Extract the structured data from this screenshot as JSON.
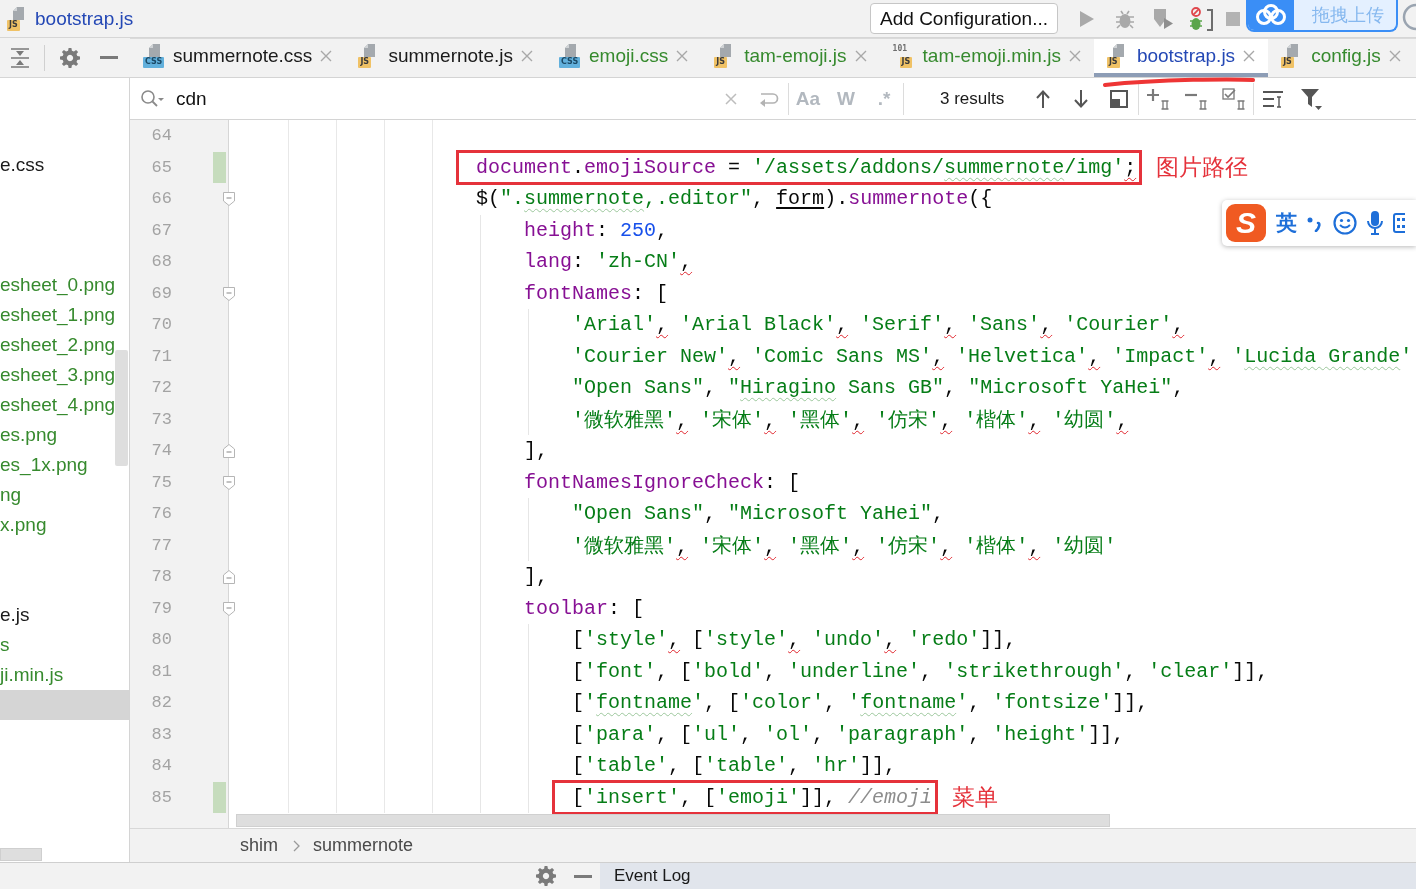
{
  "title": {
    "name": "bootstrap.js",
    "kind": "js",
    "icon_label": "JS",
    "color": "#2448b5"
  },
  "run_config": {
    "label": "Add Configuration..."
  },
  "upload_widget": {
    "label": "拖拽上传"
  },
  "tabs": [
    {
      "name": "summernote.css",
      "kind": "css",
      "icon_label": "CSS",
      "color": "#1a1a1a",
      "selected": false,
      "marked": false
    },
    {
      "name": "summernote.js",
      "kind": "js",
      "icon_label": "JS",
      "color": "#1a1a1a",
      "selected": false,
      "marked": false
    },
    {
      "name": "emoji.css",
      "kind": "css",
      "icon_label": "CSS",
      "color": "#368a2e",
      "selected": false,
      "marked": false
    },
    {
      "name": "tam-emoji.js",
      "kind": "js",
      "icon_label": "JS",
      "color": "#368a2e",
      "selected": false,
      "marked": false
    },
    {
      "name": "tam-emoji.min.js",
      "kind": "min_js",
      "icon_label": "JS",
      "icon_digits": "101",
      "color": "#368a2e",
      "selected": false,
      "marked": false
    },
    {
      "name": "bootstrap.js",
      "kind": "js",
      "icon_label": "JS",
      "color": "#2448b5",
      "selected": true,
      "marked": true
    },
    {
      "name": "config.js",
      "kind": "js",
      "icon_label": "JS",
      "color": "#368a2e",
      "selected": false,
      "marked": false
    }
  ],
  "search": {
    "value": "cdn",
    "options": [
      {
        "label": "Aa",
        "selected": false
      },
      {
        "label": "W",
        "selected": false
      },
      {
        "label": ".*",
        "selected": false
      }
    ],
    "results": "3 results"
  },
  "sidebar": {
    "items": [
      {
        "label": "e.css",
        "color": "#1a1a1a",
        "selected": false
      },
      {
        "selected": false
      },
      {
        "selected": false
      },
      {
        "selected": false
      },
      {
        "label": "esheet_0.png",
        "color": "#368a2e",
        "selected": false
      },
      {
        "label": "esheet_1.png",
        "color": "#368a2e",
        "selected": false
      },
      {
        "label": "esheet_2.png",
        "color": "#368a2e",
        "selected": false
      },
      {
        "label": "esheet_3.png",
        "color": "#368a2e",
        "selected": false
      },
      {
        "label": "esheet_4.png",
        "color": "#368a2e",
        "selected": false
      },
      {
        "label": "es.png",
        "color": "#368a2e",
        "selected": false
      },
      {
        "label": "es_1x.png",
        "color": "#368a2e",
        "selected": false
      },
      {
        "label": "ng",
        "color": "#368a2e",
        "selected": false
      },
      {
        "label": "x.png",
        "color": "#368a2e",
        "selected": false
      },
      {
        "selected": false
      },
      {
        "selected": false
      },
      {
        "label": "e.js",
        "color": "#1a1a1a",
        "selected": false
      },
      {
        "label": "s",
        "color": "#368a2e",
        "selected": false
      },
      {
        "label": "ji.min.js",
        "color": "#368a2e",
        "selected": false
      },
      {
        "selected": true
      }
    ]
  },
  "editor": {
    "lines": [
      {
        "number": "64",
        "changed": false
      },
      {
        "number": "65",
        "changed": true,
        "annotation": "图片路径",
        "tokens": [
          {
            "kind": "property",
            "text": "document"
          },
          {
            "kind": "plain",
            "text": "."
          },
          {
            "kind": "property",
            "text": "emojiSource"
          },
          {
            "kind": "plain",
            "text": " = "
          },
          {
            "kind": "string",
            "text": "'/assets/addons/"
          },
          {
            "kind": "typo",
            "text": "summernote"
          },
          {
            "kind": "string",
            "text": "/img'"
          },
          {
            "kind": "warning",
            "text": ";"
          }
        ]
      },
      {
        "number": "66",
        "kind": "block_start",
        "changed": false,
        "tokens": [
          {
            "kind": "plain",
            "text": "$("
          },
          {
            "kind": "string",
            "text": "\"."
          },
          {
            "kind": "typo",
            "text": "summernote"
          },
          {
            "kind": "string",
            "text": ",.editor\""
          },
          {
            "kind": "plain",
            "text": ", "
          },
          {
            "kind": "reference",
            "text": "form"
          },
          {
            "kind": "plain",
            "text": ")."
          },
          {
            "kind": "property",
            "text": "summernote"
          },
          {
            "kind": "plain",
            "text": "({"
          }
        ],
        "children": [
          {
            "number": "67",
            "changed": false,
            "tokens": [
              {
                "kind": "property",
                "text": "height"
              },
              {
                "kind": "plain",
                "text": ": "
              },
              {
                "kind": "number",
                "text": "250"
              },
              {
                "kind": "plain",
                "text": ","
              }
            ]
          },
          {
            "number": "68",
            "changed": false,
            "tokens": [
              {
                "kind": "property",
                "text": "lang"
              },
              {
                "kind": "plain",
                "text": ": "
              },
              {
                "kind": "string",
                "text": "'zh-CN'"
              },
              {
                "kind": "warning",
                "text": ","
              }
            ]
          },
          {
            "number": "69",
            "kind": "block_start",
            "changed": false,
            "tokens": [
              {
                "kind": "property",
                "text": "fontNames"
              },
              {
                "kind": "plain",
                "text": ": ["
              }
            ],
            "children": [
              {
                "number": "70",
                "changed": false,
                "tokens": [
                  {
                    "kind": "string",
                    "text": "'Arial'"
                  },
                  {
                    "kind": "warning",
                    "text": ","
                  },
                  {
                    "kind": "string",
                    "text": " 'Arial Black'"
                  },
                  {
                    "kind": "warning",
                    "text": ","
                  },
                  {
                    "kind": "string",
                    "text": " 'Serif'"
                  },
                  {
                    "kind": "warning",
                    "text": ","
                  },
                  {
                    "kind": "string",
                    "text": " 'Sans'"
                  },
                  {
                    "kind": "warning",
                    "text": ","
                  },
                  {
                    "kind": "string",
                    "text": " 'Courier'"
                  },
                  {
                    "kind": "warning",
                    "text": ","
                  }
                ]
              },
              {
                "number": "71",
                "changed": false,
                "tokens": [
                  {
                    "kind": "string",
                    "text": "'Courier New'"
                  },
                  {
                    "kind": "warning",
                    "text": ","
                  },
                  {
                    "kind": "string",
                    "text": " 'Comic Sans MS'"
                  },
                  {
                    "kind": "warning",
                    "text": ","
                  },
                  {
                    "kind": "string",
                    "text": " 'Helvetica'"
                  },
                  {
                    "kind": "warning",
                    "text": ","
                  },
                  {
                    "kind": "string",
                    "text": " 'Impact'"
                  },
                  {
                    "kind": "warning",
                    "text": ","
                  },
                  {
                    "kind": "string",
                    "text": " '"
                  },
                  {
                    "kind": "typo",
                    "text": "Lucida Grande"
                  },
                  {
                    "kind": "string",
                    "text": "'"
                  }
                ]
              },
              {
                "number": "72",
                "changed": false,
                "tokens": [
                  {
                    "kind": "string",
                    "text": "\"Open Sans\""
                  },
                  {
                    "kind": "plain",
                    "text": ", "
                  },
                  {
                    "kind": "string",
                    "text": "\""
                  },
                  {
                    "kind": "typo",
                    "text": "Hiragino"
                  },
                  {
                    "kind": "string",
                    "text": " Sans GB\""
                  },
                  {
                    "kind": "plain",
                    "text": ", "
                  },
                  {
                    "kind": "string",
                    "text": "\"Microsoft YaHei\""
                  },
                  {
                    "kind": "plain",
                    "text": ","
                  }
                ]
              },
              {
                "number": "73",
                "changed": false,
                "tokens": [
                  {
                    "kind": "string",
                    "text": "'微软雅黑'"
                  },
                  {
                    "kind": "warning",
                    "text": ","
                  },
                  {
                    "kind": "string",
                    "text": " '宋体'"
                  },
                  {
                    "kind": "warning",
                    "text": ","
                  },
                  {
                    "kind": "string",
                    "text": " '黑体'"
                  },
                  {
                    "kind": "warning",
                    "text": ","
                  },
                  {
                    "kind": "string",
                    "text": " '仿宋'"
                  },
                  {
                    "kind": "warning",
                    "text": ","
                  },
                  {
                    "kind": "string",
                    "text": " '楷体'"
                  },
                  {
                    "kind": "warning",
                    "text": ","
                  },
                  {
                    "kind": "string",
                    "text": " '幼圆'"
                  },
                  {
                    "kind": "warning",
                    "text": ","
                  }
                ]
              }
            ]
          },
          {
            "number": "74",
            "kind": "block_end",
            "changed": false,
            "tokens": [
              {
                "kind": "plain",
                "text": "],"
              }
            ]
          },
          {
            "number": "75",
            "kind": "block_start",
            "changed": false,
            "tokens": [
              {
                "kind": "property",
                "text": "fontNamesIgnoreCheck"
              },
              {
                "kind": "plain",
                "text": ": ["
              }
            ],
            "children": [
              {
                "number": "76",
                "changed": false,
                "tokens": [
                  {
                    "kind": "string",
                    "text": "\"Open Sans\""
                  },
                  {
                    "kind": "plain",
                    "text": ", "
                  },
                  {
                    "kind": "string",
                    "text": "\"Microsoft YaHei\""
                  },
                  {
                    "kind": "plain",
                    "text": ","
                  }
                ]
              },
              {
                "number": "77",
                "changed": false,
                "tokens": [
                  {
                    "kind": "string",
                    "text": "'微软雅黑'"
                  },
                  {
                    "kind": "warning",
                    "text": ","
                  },
                  {
                    "kind": "string",
                    "text": " '宋体'"
                  },
                  {
                    "kind": "warning",
                    "text": ","
                  },
                  {
                    "kind": "string",
                    "text": " '黑体'"
                  },
                  {
                    "kind": "warning",
                    "text": ","
                  },
                  {
                    "kind": "string",
                    "text": " '仿宋'"
                  },
                  {
                    "kind": "warning",
                    "text": ","
                  },
                  {
                    "kind": "string",
                    "text": " '楷体'"
                  },
                  {
                    "kind": "warning",
                    "text": ","
                  },
                  {
                    "kind": "string",
                    "text": " '幼圆'"
                  }
                ]
              }
            ]
          },
          {
            "number": "78",
            "kind": "block_end",
            "changed": false,
            "tokens": [
              {
                "kind": "plain",
                "text": "],"
              }
            ]
          },
          {
            "number": "79",
            "kind": "block_start",
            "changed": false,
            "tokens": [
              {
                "kind": "property",
                "text": "toolbar"
              },
              {
                "kind": "plain",
                "text": ": ["
              }
            ],
            "children": [
              {
                "number": "80",
                "changed": false,
                "tokens": [
                  {
                    "kind": "plain",
                    "text": "["
                  },
                  {
                    "kind": "string",
                    "text": "'style'"
                  },
                  {
                    "kind": "warning",
                    "text": ","
                  },
                  {
                    "kind": "plain",
                    "text": " ["
                  },
                  {
                    "kind": "string",
                    "text": "'style'"
                  },
                  {
                    "kind": "warning",
                    "text": ","
                  },
                  {
                    "kind": "string",
                    "text": " 'undo'"
                  },
                  {
                    "kind": "warning",
                    "text": ","
                  },
                  {
                    "kind": "string",
                    "text": " 'redo'"
                  },
                  {
                    "kind": "plain",
                    "text": "]],"
                  }
                ]
              },
              {
                "number": "81",
                "changed": false,
                "tokens": [
                  {
                    "kind": "plain",
                    "text": "["
                  },
                  {
                    "kind": "string",
                    "text": "'font'"
                  },
                  {
                    "kind": "plain",
                    "text": ", ["
                  },
                  {
                    "kind": "string",
                    "text": "'bold'"
                  },
                  {
                    "kind": "plain",
                    "text": ", "
                  },
                  {
                    "kind": "string",
                    "text": "'underline'"
                  },
                  {
                    "kind": "plain",
                    "text": ", "
                  },
                  {
                    "kind": "string",
                    "text": "'strikethrough'"
                  },
                  {
                    "kind": "plain",
                    "text": ", "
                  },
                  {
                    "kind": "string",
                    "text": "'clear'"
                  },
                  {
                    "kind": "plain",
                    "text": "]],"
                  }
                ]
              },
              {
                "number": "82",
                "changed": false,
                "tokens": [
                  {
                    "kind": "plain",
                    "text": "["
                  },
                  {
                    "kind": "string",
                    "text": "'"
                  },
                  {
                    "kind": "typo",
                    "text": "fontname"
                  },
                  {
                    "kind": "string",
                    "text": "'"
                  },
                  {
                    "kind": "plain",
                    "text": ", ["
                  },
                  {
                    "kind": "string",
                    "text": "'color'"
                  },
                  {
                    "kind": "plain",
                    "text": ", "
                  },
                  {
                    "kind": "string",
                    "text": "'"
                  },
                  {
                    "kind": "typo",
                    "text": "fontname"
                  },
                  {
                    "kind": "string",
                    "text": "'"
                  },
                  {
                    "kind": "plain",
                    "text": ", "
                  },
                  {
                    "kind": "string",
                    "text": "'fontsize'"
                  },
                  {
                    "kind": "plain",
                    "text": "]],"
                  }
                ]
              },
              {
                "number": "83",
                "changed": false,
                "tokens": [
                  {
                    "kind": "plain",
                    "text": "["
                  },
                  {
                    "kind": "string",
                    "text": "'para'"
                  },
                  {
                    "kind": "plain",
                    "text": ", ["
                  },
                  {
                    "kind": "string",
                    "text": "'ul'"
                  },
                  {
                    "kind": "plain",
                    "text": ", "
                  },
                  {
                    "kind": "string",
                    "text": "'ol'"
                  },
                  {
                    "kind": "plain",
                    "text": ", "
                  },
                  {
                    "kind": "string",
                    "text": "'paragraph'"
                  },
                  {
                    "kind": "plain",
                    "text": ", "
                  },
                  {
                    "kind": "string",
                    "text": "'height'"
                  },
                  {
                    "kind": "plain",
                    "text": "]],"
                  }
                ]
              },
              {
                "number": "84",
                "changed": false,
                "tokens": [
                  {
                    "kind": "plain",
                    "text": "["
                  },
                  {
                    "kind": "string",
                    "text": "'table'"
                  },
                  {
                    "kind": "plain",
                    "text": ", ["
                  },
                  {
                    "kind": "string",
                    "text": "'table'"
                  },
                  {
                    "kind": "plain",
                    "text": ", "
                  },
                  {
                    "kind": "string",
                    "text": "'hr'"
                  },
                  {
                    "kind": "plain",
                    "text": "]],"
                  }
                ]
              },
              {
                "number": "85",
                "changed": true,
                "annotation": "菜单",
                "tokens": [
                  {
                    "kind": "plain",
                    "text": "["
                  },
                  {
                    "kind": "string",
                    "text": "'insert'"
                  },
                  {
                    "kind": "plain",
                    "text": ", ["
                  },
                  {
                    "kind": "string",
                    "text": "'emoji'"
                  },
                  {
                    "kind": "plain",
                    "text": "]], "
                  },
                  {
                    "kind": "comment",
                    "text": "//emoji"
                  }
                ]
              }
            ]
          }
        ]
      }
    ]
  },
  "ime_toolbar": {
    "logo": "S",
    "mode": "英"
  },
  "breadcrumbs": [
    "shim",
    "summernote"
  ],
  "bottom_bar": {
    "tool_window": "Event Log"
  }
}
